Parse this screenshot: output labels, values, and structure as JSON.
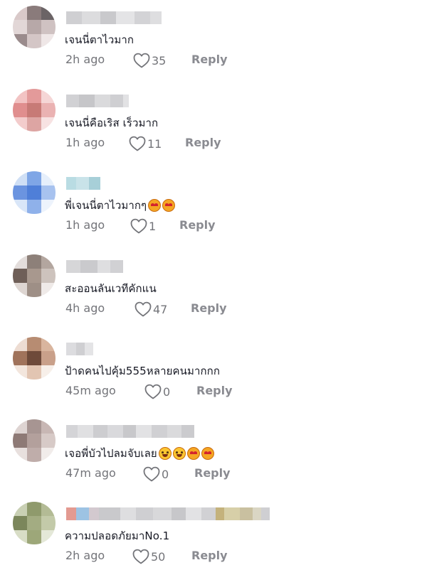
{
  "comments": [
    {
      "text": "เจนนี่ตาไวมาก",
      "emojis": [],
      "time": "2h ago",
      "likes": "35",
      "reply": "Reply"
    },
    {
      "text": "เจนนี่คือเริส เร็วมาก",
      "emojis": [],
      "time": "1h ago",
      "likes": "11",
      "reply": "Reply"
    },
    {
      "text": "พี่เจนนี่ตาไวมากๆ",
      "emojis": [
        "heart-eyes-emoji",
        "heart-eyes-emoji"
      ],
      "time": "1h ago",
      "likes": "1",
      "reply": "Reply"
    },
    {
      "text": "สะออนลันเวทีคักแน",
      "emojis": [],
      "time": "4h ago",
      "likes": "47",
      "reply": "Reply"
    },
    {
      "text": "ป้าดคนไปคุ้ม555หลายคนมากกก",
      "emojis": [],
      "time": "45m ago",
      "likes": "0",
      "reply": "Reply"
    },
    {
      "text": "เจอพี่บัวไปลมจับเลย",
      "emojis": [
        "grinning-emoji",
        "grinning-emoji",
        "heart-eyes-emoji",
        "heart-eyes-emoji"
      ],
      "time": "47m ago",
      "likes": "0",
      "reply": "Reply"
    },
    {
      "text": "ความปลอดภัยมาNo.1",
      "emojis": [],
      "time": "2h ago",
      "likes": "50",
      "reply": "Reply"
    }
  ],
  "colors": {
    "text": "#161823",
    "meta": "#737479",
    "reply": "#8a8b91",
    "avatar_palettes": [
      [
        "#d9c9c9",
        "#8a7b7b",
        "#6b6466",
        "#e2d7d7",
        "#b7a8a8",
        "#cfc2c2",
        "#9a8b8c",
        "#d4c6c6",
        "#efe7e7"
      ],
      [
        "#f2c3c3",
        "#e39a9a",
        "#f5d6d6",
        "#e08e8e",
        "#c77a76",
        "#eab2b2",
        "#f3cccc",
        "#dda5a3",
        "#f7e2e2"
      ],
      [
        "#cfdff5",
        "#7fa6e6",
        "#e6effb",
        "#6b94e0",
        "#4f7fd8",
        "#a7c2ef",
        "#d9e6f8",
        "#8fb1ea",
        "#edf3fc"
      ],
      [
        "#e3dddb",
        "#8d8079",
        "#b3a69f",
        "#6f5f58",
        "#a8988e",
        "#cdc3bd",
        "#ded6d2",
        "#9e8f86",
        "#efeae8"
      ],
      [
        "#eddcd2",
        "#b78c72",
        "#d9b59e",
        "#a0735b",
        "#6e4a3a",
        "#c9a08a",
        "#f3e6dd",
        "#e2c5b2",
        "#f7efe9"
      ],
      [
        "#ded4d2",
        "#a79592",
        "#c8b7b4",
        "#8e7a76",
        "#b3a09c",
        "#d7cac7",
        "#e8e0de",
        "#bfadaa",
        "#f1ecea"
      ],
      [
        "#c9d0b4",
        "#8f9a6c",
        "#b3bb95",
        "#7b865b",
        "#a3ac82",
        "#c3caa9",
        "#d8ddc6",
        "#9da779",
        "#e4e8d8"
      ]
    ],
    "name_palettes": [
      [
        "#cfcfd2",
        "#dcdcde",
        "#c9c9cc",
        "#e4e4e6",
        "#d3d3d6",
        "#dedee0"
      ],
      [
        "#d1d1d4",
        "#c6c6c9",
        "#dadadc",
        "#cfcfd2",
        "#e2e2e4"
      ],
      [
        "#b9dce3",
        "#c9e3e9",
        "#a7cfd8"
      ],
      [
        "#d6d6d8",
        "#cacacd",
        "#dedee0",
        "#d1d1d4"
      ],
      [
        "#dcdcdf",
        "#cfcfd2",
        "#e4e4e6"
      ],
      [
        "#d4d4d7",
        "#e0e0e2",
        "#cdcdd0",
        "#d9d9dc",
        "#c8c8cb",
        "#e2e2e4",
        "#d0d0d3",
        "#dadadc",
        "#cbcbce"
      ],
      [
        "#e39a91",
        "#9dc3e3",
        "#d3c9cf",
        "#c9c9cc",
        "#dedee0",
        "#cfcfd2",
        "#d8d8da",
        "#c7c7ca",
        "#e2e2e4",
        "#d1d1d4",
        "#c4b27c",
        "#d7cfa8",
        "#c9c0a0",
        "#dad6c4",
        "#cfcfd2"
      ]
    ]
  }
}
